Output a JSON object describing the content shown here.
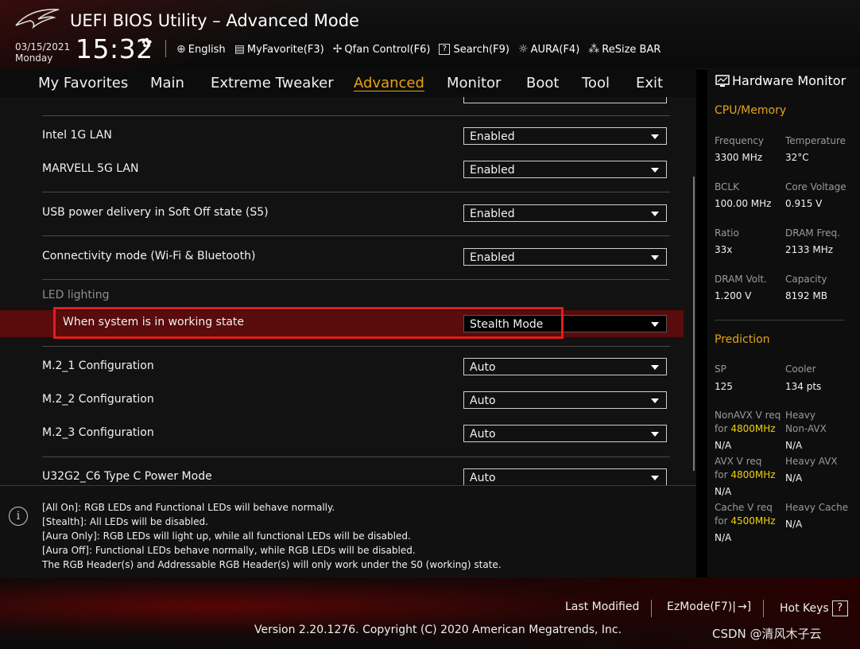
{
  "header": {
    "title": "UEFI BIOS Utility – Advanced Mode",
    "date": "03/15/2021",
    "day": "Monday",
    "time": "15:32",
    "tools": [
      {
        "label": "English",
        "icon": "globe-icon"
      },
      {
        "label": "MyFavorite(F3)",
        "icon": "favorite-icon"
      },
      {
        "label": "Qfan Control(F6)",
        "icon": "fan-icon"
      },
      {
        "label": "Search(F9)",
        "icon": "search-icon"
      },
      {
        "label": "AURA(F4)",
        "icon": "aura-icon"
      },
      {
        "label": "ReSize BAR",
        "icon": "resize-bar-icon"
      }
    ]
  },
  "nav": {
    "tabs": [
      "My Favorites",
      "Main",
      "Extreme Tweaker",
      "Advanced",
      "Monitor",
      "Boot",
      "Tool",
      "Exit"
    ],
    "active": "Advanced"
  },
  "settings": {
    "intel_lan": {
      "label": "Intel 1G LAN",
      "value": "Enabled"
    },
    "marvell_lan": {
      "label": "MARVELL 5G LAN",
      "value": "Enabled"
    },
    "usb_power": {
      "label": "USB power delivery in Soft Off state (S5)",
      "value": "Enabled"
    },
    "connectivity": {
      "label": "Connectivity mode (Wi-Fi & Bluetooth)",
      "value": "Enabled"
    },
    "led_section": "LED lighting",
    "led_working": {
      "label": "When system is in working state",
      "value": "Stealth Mode"
    },
    "m2_1": {
      "label": "M.2_1 Configuration",
      "value": "Auto"
    },
    "m2_2": {
      "label": "M.2_2 Configuration",
      "value": "Auto"
    },
    "m2_3": {
      "label": "M.2_3 Configuration",
      "value": "Auto"
    },
    "u32g2": {
      "label": "U32G2_C6 Type C Power Mode",
      "value": "Auto"
    }
  },
  "help": {
    "lines": [
      "[All On]: RGB LEDs and Functional LEDs will behave normally.",
      "[Stealth]: All LEDs will be disabled.",
      "[Aura Only]: RGB LEDs will light up, while all functional LEDs will be disabled.",
      "[Aura Off]: Functional LEDs behave normally, while RGB LEDs will be disabled.",
      "The RGB Header(s) and Addressable RGB Header(s) will only work under the S0 (working) state."
    ]
  },
  "monitor": {
    "title": "Hardware Monitor",
    "cpu_section": "CPU/Memory",
    "frequency": {
      "label": "Frequency",
      "value": "3300 MHz"
    },
    "temperature": {
      "label": "Temperature",
      "value": "32°C"
    },
    "bclk": {
      "label": "BCLK",
      "value": "100.00 MHz"
    },
    "core_voltage": {
      "label": "Core Voltage",
      "value": "0.915 V"
    },
    "ratio": {
      "label": "Ratio",
      "value": "33x"
    },
    "dram_freq": {
      "label": "DRAM Freq.",
      "value": "2133 MHz"
    },
    "dram_volt": {
      "label": "DRAM Volt.",
      "value": "1.200 V"
    },
    "capacity": {
      "label": "Capacity",
      "value": "8192 MB"
    },
    "prediction_section": "Prediction",
    "sp": {
      "label": "SP",
      "value": "125"
    },
    "cooler": {
      "label": "Cooler",
      "value": "134 pts"
    },
    "nonavx": {
      "label": "NonAVX V req",
      "for": "for",
      "freq": "4800MHz",
      "value": "N/A"
    },
    "heavy_nonavx": {
      "label1": "Heavy",
      "label2": "Non-AVX",
      "value": "N/A"
    },
    "avx": {
      "label": "AVX V req",
      "for": "for",
      "freq": "4800MHz",
      "value": "N/A"
    },
    "heavy_avx": {
      "label": "Heavy AVX",
      "value": "N/A"
    },
    "cache": {
      "label": "Cache V req",
      "for": "for",
      "freq": "4500MHz",
      "value": "N/A"
    },
    "heavy_cache": {
      "label": "Heavy Cache",
      "value": "N/A"
    }
  },
  "footer": {
    "last_modified": "Last Modified",
    "ezmode": "EzMode(F7)|",
    "hotkeys": "Hot Keys",
    "hotkeys_icon_text": "?",
    "version": "Version 2.20.1276. Copyright (C) 2020 American Megatrends, Inc.",
    "watermark": "CSDN @清风木子云"
  },
  "colors": {
    "accent": "#e8a317",
    "highlight_border": "#e11d1d",
    "highlight_row": "#5a0b0b",
    "freq_yellow": "#f5d100"
  }
}
